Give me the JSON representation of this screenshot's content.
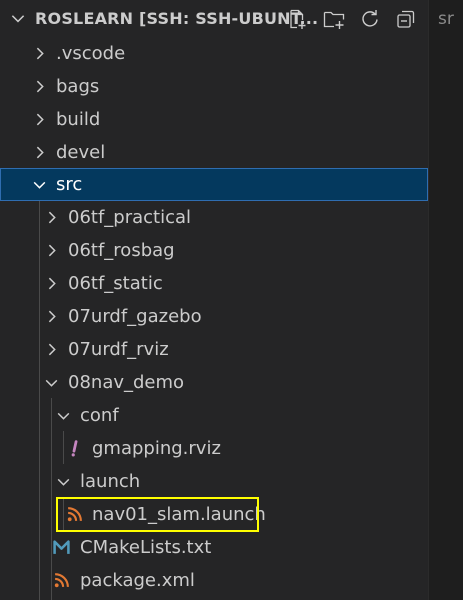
{
  "explorer": {
    "title": "ROSLEARN [SSH: SSH-UBUNT...",
    "actions": [
      {
        "name": "new-file-icon"
      },
      {
        "name": "new-folder-icon"
      },
      {
        "name": "refresh-icon"
      },
      {
        "name": "collapse-all-icon"
      }
    ],
    "tree": [
      {
        "label": ".vscode",
        "kind": "folder",
        "expanded": false
      },
      {
        "label": "bags",
        "kind": "folder",
        "expanded": false
      },
      {
        "label": "build",
        "kind": "folder",
        "expanded": false
      },
      {
        "label": "devel",
        "kind": "folder",
        "expanded": false
      },
      {
        "label": "src",
        "kind": "folder",
        "expanded": true,
        "selected": true
      },
      {
        "label": "06tf_practical",
        "kind": "folder",
        "expanded": false
      },
      {
        "label": "06tf_rosbag",
        "kind": "folder",
        "expanded": false
      },
      {
        "label": "06tf_static",
        "kind": "folder",
        "expanded": false
      },
      {
        "label": "07urdf_gazebo",
        "kind": "folder",
        "expanded": false
      },
      {
        "label": "07urdf_rviz",
        "kind": "folder",
        "expanded": false
      },
      {
        "label": "08nav_demo",
        "kind": "folder",
        "expanded": true
      },
      {
        "label": "conf",
        "kind": "folder",
        "expanded": true
      },
      {
        "label": "gmapping.rviz",
        "kind": "file",
        "icon": "exclamation-icon"
      },
      {
        "label": "launch",
        "kind": "folder",
        "expanded": true
      },
      {
        "label": "nav01_slam.launch",
        "kind": "file",
        "icon": "rss-icon",
        "highlighted": true
      },
      {
        "label": "CMakeLists.txt",
        "kind": "file",
        "icon": "cmake-m-icon"
      },
      {
        "label": "package.xml",
        "kind": "file",
        "icon": "rss-icon"
      }
    ]
  },
  "editor": {
    "tab_fragment": "sr"
  },
  "colors": {
    "sidebar_bg": "#252526",
    "selected_bg": "#04395e",
    "selected_border": "#2f6db0",
    "highlight_border": "#ffff00",
    "rss_orange": "#e37933",
    "exclaim_purple": "#c586c0",
    "cmake_blue": "#519aba"
  }
}
